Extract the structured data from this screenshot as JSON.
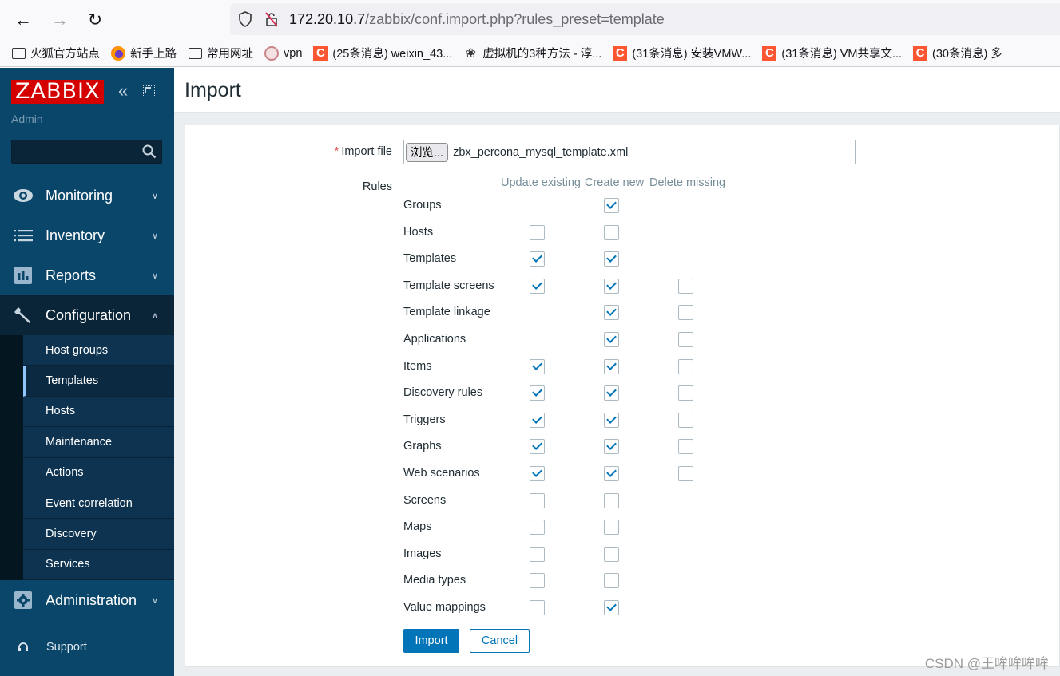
{
  "browser": {
    "url_host": "172.20.10.7",
    "url_path": "/zabbix/conf.import.php?rules_preset=template",
    "bookmarks": [
      {
        "icon": "folder-icon",
        "label": "火狐官方站点"
      },
      {
        "icon": "firefox-icon",
        "label": "新手上路"
      },
      {
        "icon": "folder-icon",
        "label": "常用网址"
      },
      {
        "icon": "vpn-icon",
        "label": "vpn"
      },
      {
        "icon": "csdn-icon",
        "label": "(25条消息) weixin_43..."
      },
      {
        "icon": "vm-icon",
        "label": "虚拟机的3种方法 - 淳..."
      },
      {
        "icon": "csdn-icon",
        "label": "(31条消息) 安装VMW..."
      },
      {
        "icon": "csdn-icon",
        "label": "(31条消息) VM共享文..."
      },
      {
        "icon": "csdn-icon",
        "label": "(30条消息) 多"
      }
    ]
  },
  "sidebar": {
    "logo": "ZABBIX",
    "collapse_glyph": "«",
    "user": "Admin",
    "search_placeholder": "",
    "menu": [
      {
        "label": "Monitoring",
        "icon": "eye-icon",
        "expanded": false
      },
      {
        "label": "Inventory",
        "icon": "list-icon",
        "expanded": false
      },
      {
        "label": "Reports",
        "icon": "bar-chart-icon",
        "expanded": false
      },
      {
        "label": "Configuration",
        "icon": "wrench-icon",
        "expanded": true
      },
      {
        "label": "Administration",
        "icon": "gear-icon",
        "expanded": false
      }
    ],
    "submenu": [
      {
        "label": "Host groups",
        "selected": false
      },
      {
        "label": "Templates",
        "selected": true
      },
      {
        "label": "Hosts",
        "selected": false
      },
      {
        "label": "Maintenance",
        "selected": false
      },
      {
        "label": "Actions",
        "selected": false
      },
      {
        "label": "Event correlation",
        "selected": false
      },
      {
        "label": "Discovery",
        "selected": false
      },
      {
        "label": "Services",
        "selected": false
      }
    ],
    "support": "Support"
  },
  "page": {
    "title": "Import",
    "import_file_label": "Import file",
    "required_mark": "*",
    "browse_label": "浏览...",
    "file_name": "zbx_percona_mysql_template.xml",
    "rules_label": "Rules",
    "columns": [
      "Update existing",
      "Create new",
      "Delete missing"
    ],
    "rules": [
      {
        "name": "Groups",
        "update": null,
        "create": true,
        "delete": null
      },
      {
        "name": "Hosts",
        "update": false,
        "create": false,
        "delete": null
      },
      {
        "name": "Templates",
        "update": true,
        "create": true,
        "delete": null
      },
      {
        "name": "Template screens",
        "update": true,
        "create": true,
        "delete": false
      },
      {
        "name": "Template linkage",
        "update": null,
        "create": true,
        "delete": false
      },
      {
        "name": "Applications",
        "update": null,
        "create": true,
        "delete": false
      },
      {
        "name": "Items",
        "update": true,
        "create": true,
        "delete": false
      },
      {
        "name": "Discovery rules",
        "update": true,
        "create": true,
        "delete": false
      },
      {
        "name": "Triggers",
        "update": true,
        "create": true,
        "delete": false
      },
      {
        "name": "Graphs",
        "update": true,
        "create": true,
        "delete": false
      },
      {
        "name": "Web scenarios",
        "update": true,
        "create": true,
        "delete": false
      },
      {
        "name": "Screens",
        "update": false,
        "create": false,
        "delete": null
      },
      {
        "name": "Maps",
        "update": false,
        "create": false,
        "delete": null
      },
      {
        "name": "Images",
        "update": false,
        "create": false,
        "delete": null
      },
      {
        "name": "Media types",
        "update": false,
        "create": false,
        "delete": null
      },
      {
        "name": "Value mappings",
        "update": false,
        "create": true,
        "delete": null
      }
    ],
    "import_button": "Import",
    "cancel_button": "Cancel"
  },
  "watermark": "CSDN @王哞哞哞哞",
  "colors": {
    "sidebar_bg": "#0a466a",
    "accent": "#0275b8",
    "logo_bg": "#d40000"
  }
}
